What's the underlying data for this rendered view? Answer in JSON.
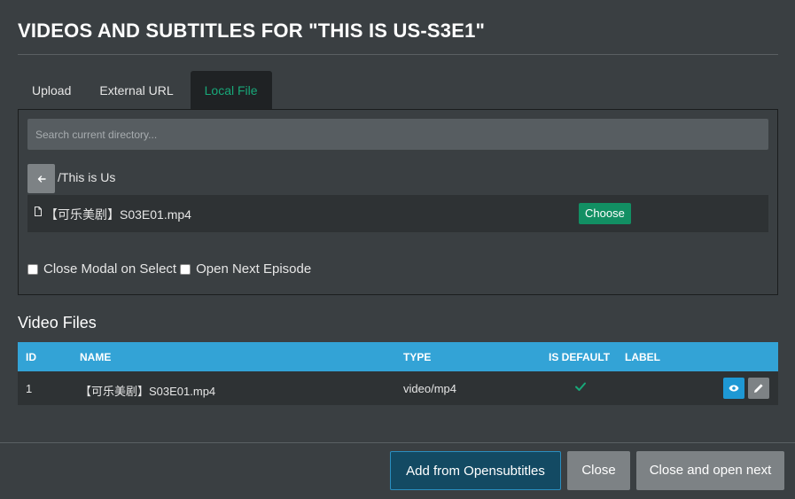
{
  "modal": {
    "title": "VIDEOS AND SUBTITLES FOR \"THIS IS US-S3E1\""
  },
  "tabs": [
    {
      "label": "Upload",
      "active": false
    },
    {
      "label": "External URL",
      "active": false
    },
    {
      "label": "Local File",
      "active": true
    }
  ],
  "local_file": {
    "search_placeholder": "Search current directory...",
    "search_value": "",
    "back_icon": "arrow-left-icon",
    "current_path": "/This is Us",
    "files": [
      {
        "icon": "file-icon",
        "name": "【可乐美剧】S03E01.mp4",
        "action_label": "Choose"
      }
    ],
    "options": [
      {
        "label": "Close Modal on Select",
        "checked": false
      },
      {
        "label": "Open Next Episode",
        "checked": false
      }
    ]
  },
  "video_files": {
    "title": "Video Files",
    "columns": [
      "ID",
      "NAME",
      "TYPE",
      "IS DEFAULT",
      "LABEL"
    ],
    "rows": [
      {
        "id": "1",
        "name": "【可乐美剧】S03E01.mp4",
        "type": "video/mp4",
        "is_default": true,
        "label": ""
      }
    ]
  },
  "footer": {
    "add_opensubtitles": "Add from Opensubtitles",
    "close": "Close",
    "close_and_next": "Close and open next"
  },
  "colors": {
    "background": "#3a3f42",
    "accent_green": "#18a879",
    "table_header": "#33a3d6",
    "choose_button": "#128f63"
  }
}
